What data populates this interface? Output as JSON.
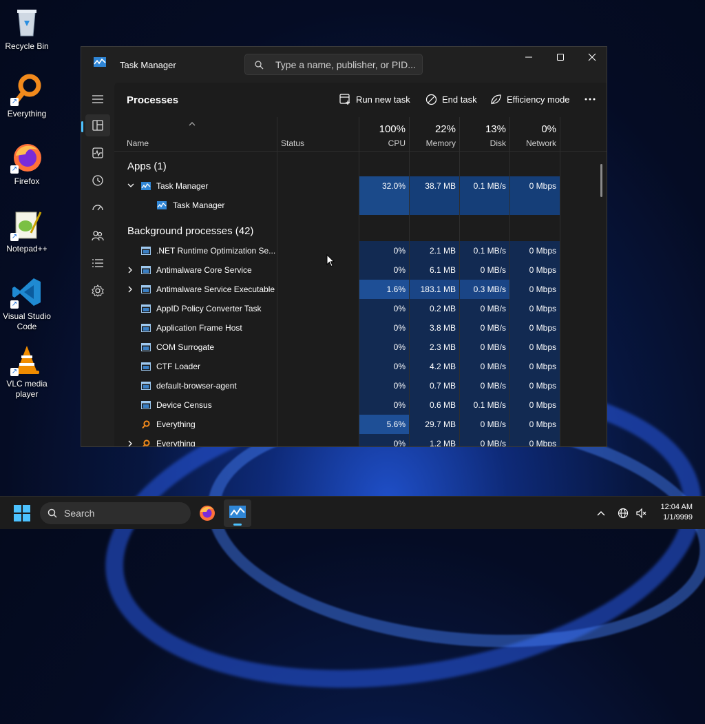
{
  "desktop": {
    "icons": [
      {
        "label": "Recycle Bin"
      },
      {
        "label": "Everything"
      },
      {
        "label": "Firefox"
      },
      {
        "label": "Notepad++"
      },
      {
        "label": "Visual Studio Code"
      },
      {
        "label": "VLC media player"
      }
    ]
  },
  "window": {
    "title": "Task Manager",
    "search_placeholder": "Type a name, publisher, or PID..."
  },
  "toolbar": {
    "page_title": "Processes",
    "run_new_task": "Run new task",
    "end_task": "End task",
    "efficiency_mode": "Efficiency mode",
    "more_icon": "more-icon"
  },
  "columns": {
    "name": "Name",
    "status": "Status",
    "cpu_pct": "100%",
    "cpu": "CPU",
    "memory_pct": "22%",
    "memory": "Memory",
    "disk_pct": "13%",
    "disk": "Disk",
    "network_pct": "0%",
    "network": "Network"
  },
  "groups": {
    "apps": "Apps (1)",
    "background": "Background processes (42)"
  },
  "apps": [
    {
      "name": "Task Manager",
      "cpu": "32.0%",
      "memory": "38.7 MB",
      "disk": "0.1 MB/s",
      "network": "0 Mbps",
      "expanded": true
    },
    {
      "name": "Task Manager",
      "cpu": "",
      "memory": "",
      "disk": "",
      "network": ""
    }
  ],
  "processes": [
    {
      "name": ".NET Runtime Optimization Se...",
      "cpu": "0%",
      "memory": "2.1 MB",
      "disk": "0.1 MB/s",
      "network": "0 Mbps"
    },
    {
      "name": "Antimalware Core Service",
      "cpu": "0%",
      "memory": "6.1 MB",
      "disk": "0 MB/s",
      "network": "0 Mbps"
    },
    {
      "name": "Antimalware Service Executable",
      "cpu": "1.6%",
      "memory": "183.1 MB",
      "disk": "0.3 MB/s",
      "network": "0 Mbps"
    },
    {
      "name": "AppID Policy Converter Task",
      "cpu": "0%",
      "memory": "0.2 MB",
      "disk": "0 MB/s",
      "network": "0 Mbps"
    },
    {
      "name": "Application Frame Host",
      "cpu": "0%",
      "memory": "3.8 MB",
      "disk": "0 MB/s",
      "network": "0 Mbps"
    },
    {
      "name": "COM Surrogate",
      "cpu": "0%",
      "memory": "2.3 MB",
      "disk": "0 MB/s",
      "network": "0 Mbps"
    },
    {
      "name": "CTF Loader",
      "cpu": "0%",
      "memory": "4.2 MB",
      "disk": "0 MB/s",
      "network": "0 Mbps"
    },
    {
      "name": "default-browser-agent",
      "cpu": "0%",
      "memory": "0.7 MB",
      "disk": "0 MB/s",
      "network": "0 Mbps"
    },
    {
      "name": "Device Census",
      "cpu": "0%",
      "memory": "0.6 MB",
      "disk": "0.1 MB/s",
      "network": "0 Mbps"
    },
    {
      "name": "Everything",
      "cpu": "5.6%",
      "memory": "29.7 MB",
      "disk": "0 MB/s",
      "network": "0 Mbps"
    },
    {
      "name": "Everything",
      "cpu": "0%",
      "memory": "1.2 MB",
      "disk": "0 MB/s",
      "network": "0 Mbps"
    }
  ],
  "taskbar": {
    "search_label": "Search",
    "time": "12:04 AM",
    "date": "1/1/9999"
  }
}
